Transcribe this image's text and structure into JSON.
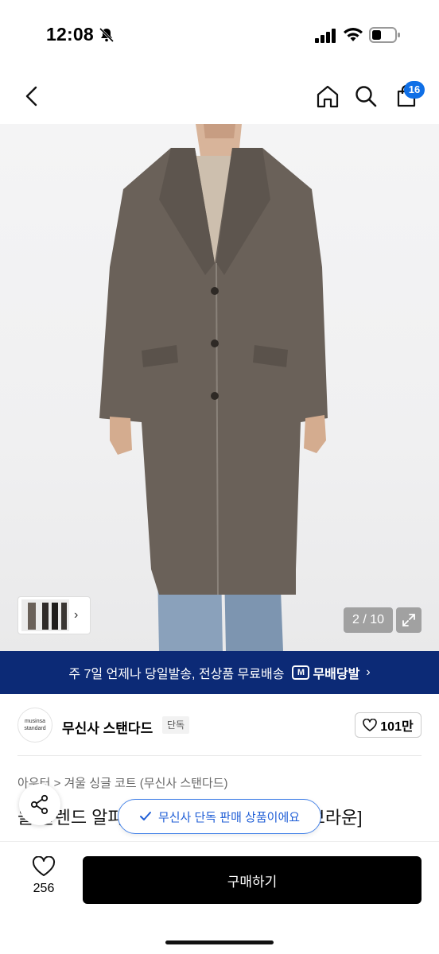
{
  "status_bar": {
    "time": "12:08"
  },
  "nav": {
    "cart_count": "16"
  },
  "gallery": {
    "page_counter": "2 / 10",
    "thumb_arrow": "›"
  },
  "promo": {
    "text": "주 7일 언제나 당일발송, 전상품 무료배송",
    "logo_label": "무배당발",
    "logo_mark": "M",
    "chevron": "›"
  },
  "brand": {
    "logo_line1": "musinsa",
    "logo_line2": "standard",
    "name": "무신사 스탠다드",
    "tag": "단독",
    "like_count": "101만"
  },
  "product": {
    "breadcrumb": "아우터 > 겨울 싱글 코트 (무신사 스탠다드)",
    "title": "울 블렌드 알파카 싱글 브레스티드 코트 [브라운]"
  },
  "toast": {
    "text": "무신사 단독 판매 상품이에요"
  },
  "bottom_bar": {
    "like_count": "256",
    "buy_label": "구매하기"
  },
  "colors": {
    "promo_bg": "#0c2a76",
    "accent": "#0f6fe6",
    "coat": "#6a6159"
  }
}
